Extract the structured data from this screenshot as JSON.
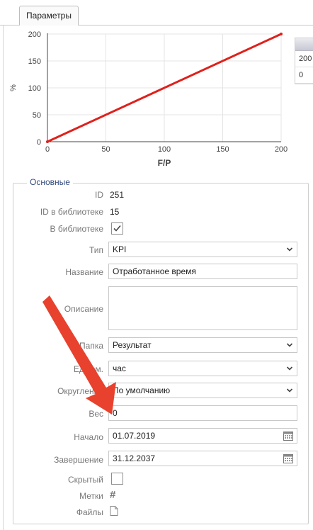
{
  "tabs": [
    {
      "label": "Параметры",
      "active": true
    }
  ],
  "chart_data": {
    "type": "line",
    "x": [
      0,
      200
    ],
    "series": [
      {
        "values": [
          0,
          200
        ],
        "color": "#e0201b"
      }
    ],
    "xlabel": "F/P",
    "ylabel": "%",
    "xlim": [
      0,
      200
    ],
    "ylim": [
      0,
      200
    ],
    "xticks": [
      0,
      50,
      100,
      150,
      200
    ],
    "yticks": [
      0,
      50,
      100,
      150,
      200
    ],
    "grid": true
  },
  "side_table": {
    "rows": [
      "200",
      "0"
    ]
  },
  "form": {
    "legend": "Основные",
    "id_label": "ID",
    "id_value": "251",
    "lib_id_label": "ID в библиотеке",
    "lib_id_value": "15",
    "in_lib_label": "В библиотеке",
    "in_lib_checked": true,
    "type_label": "Тип",
    "type_value": "KPI",
    "name_label": "Название",
    "name_value": "Отработанное время",
    "desc_label": "Описание",
    "desc_value": "",
    "folder_label": "Папка",
    "folder_value": "Результат",
    "unit_label": "Ед.изм.",
    "unit_value": "час",
    "round_label": "Округление",
    "round_value": "По умолчанию",
    "weight_label": "Вес",
    "weight_value": "0",
    "start_label": "Начало",
    "start_value": "01.07.2019",
    "end_label": "Завершение",
    "end_value": "31.12.2037",
    "hidden_label": "Скрытый",
    "hidden_checked": false,
    "tags_label": "Метки",
    "files_label": "Файлы"
  },
  "colors": {
    "accent": "#334b7e",
    "annotation_arrow": "#e8412e",
    "line": "#e0201b"
  },
  "icons": {
    "checkbox": "check-icon",
    "select": "chevron-down-icon",
    "date": "calendar-icon",
    "tags": "hash-icon",
    "files": "file-icon"
  }
}
